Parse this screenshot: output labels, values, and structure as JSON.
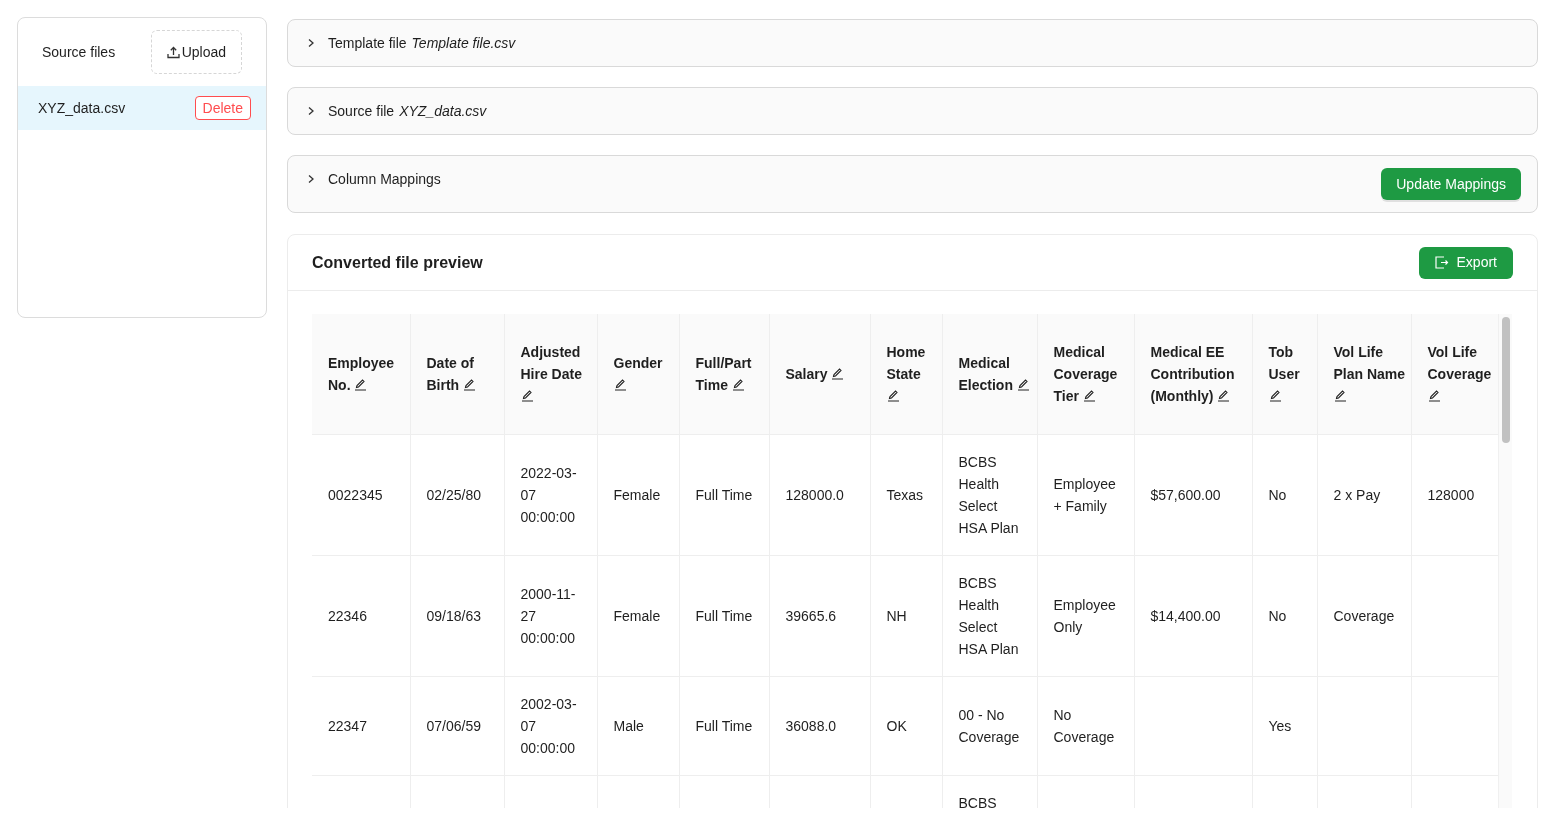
{
  "source_panel": {
    "title": "Source files",
    "upload_button": "Upload",
    "files": [
      {
        "name": "XYZ_data.csv",
        "selected": true,
        "delete_button": "Delete"
      }
    ]
  },
  "sections": [
    {
      "label": "Template file",
      "value": "Template file.csv",
      "expanded": false
    },
    {
      "label": "Source file",
      "value": "XYZ_data.csv",
      "expanded": false
    },
    {
      "label": "Column Mappings",
      "expanded": false,
      "action_button": "Update Mappings"
    }
  ],
  "preview": {
    "title": "Converted file preview",
    "export_button": "Export",
    "table": {
      "columns": [
        {
          "label": "Employee No.",
          "editable": true
        },
        {
          "label": "Date of Birth",
          "editable": true
        },
        {
          "label": "Adjusted Hire Date",
          "editable": true
        },
        {
          "label": "Gender",
          "editable": true
        },
        {
          "label": "Full/Part Time",
          "editable": true
        },
        {
          "label": "Salary",
          "editable": true
        },
        {
          "label": "Home State",
          "editable": true
        },
        {
          "label": "Medical Election",
          "editable": true
        },
        {
          "label": "Medical Coverage Tier",
          "editable": true
        },
        {
          "label": "Medical EE Contribution (Monthly)",
          "editable": true
        },
        {
          "label": "Tob User",
          "editable": true
        },
        {
          "label": "Vol Life Plan Name",
          "editable": true
        },
        {
          "label": "Vol Life Coverage",
          "editable": true
        }
      ],
      "rows": [
        [
          "0022345",
          "02/25/80",
          "2022-03-07 00:00:00",
          "Female",
          "Full Time",
          "128000.0",
          "Texas",
          "BCBS Health Select HSA Plan",
          "Employee + Family",
          "$57,600.00",
          "No",
          "2 x Pay",
          "128000"
        ],
        [
          "22346",
          "09/18/63",
          "2000-11-27 00:00:00",
          "Female",
          "Full Time",
          "39665.6",
          "NH",
          "BCBS Health Select HSA Plan",
          "Employee Only",
          "$14,400.00",
          "No",
          "Coverage",
          null
        ],
        [
          "22347",
          "07/06/59",
          "2002-03-07 00:00:00",
          "Male",
          "Full Time",
          "36088.0",
          "OK",
          "00 - No Coverage",
          "No Coverage",
          null,
          "Yes",
          null,
          null
        ],
        [
          null,
          null,
          null,
          null,
          null,
          null,
          null,
          "BCBS",
          null,
          null,
          null,
          null,
          null
        ]
      ]
    }
  }
}
